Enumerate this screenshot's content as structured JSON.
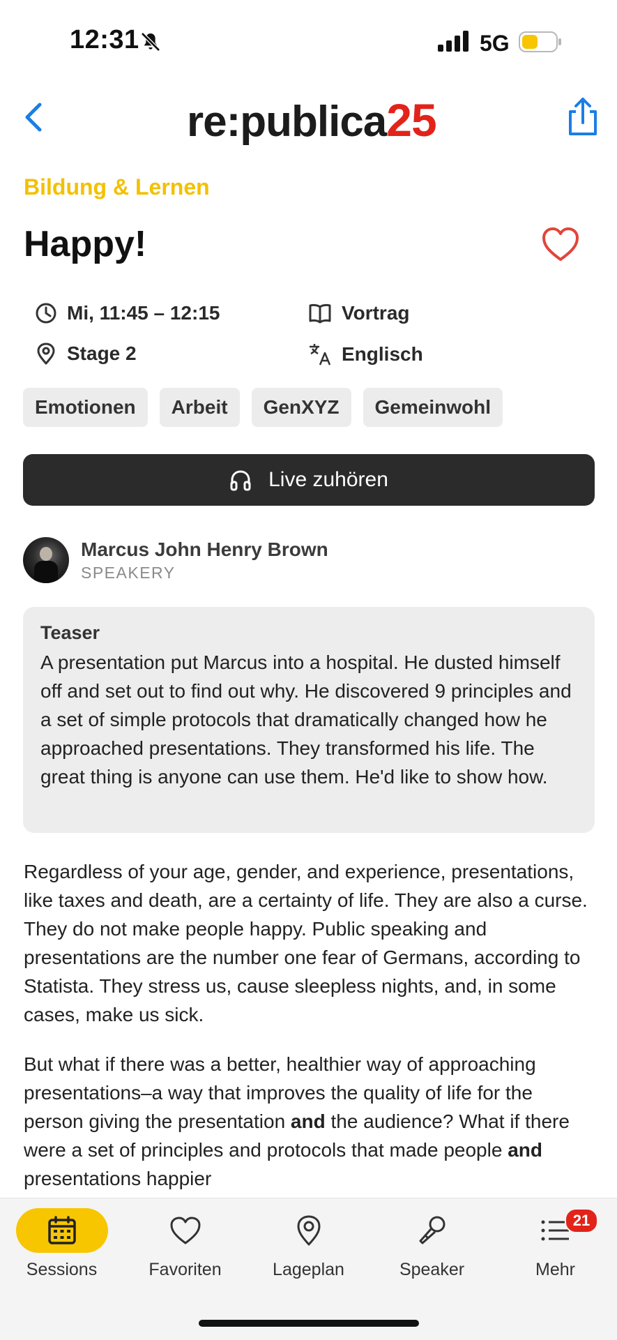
{
  "status_bar": {
    "time": "12:31",
    "network": "5G"
  },
  "header": {
    "logo_text": "re:publica",
    "logo_number": "25"
  },
  "session": {
    "category": "Bildung & Lernen",
    "title": "Happy!",
    "time": "Mi, 11:45 – 12:15",
    "format": "Vortrag",
    "location": "Stage 2",
    "language": "Englisch",
    "tags": [
      "Emotionen",
      "Arbeit",
      "GenXYZ",
      "Gemeinwohl"
    ],
    "listen_label": "Live zuhören"
  },
  "speaker": {
    "name": "Marcus John Henry Brown",
    "org": "SPEAKERY"
  },
  "teaser": {
    "label": "Teaser",
    "text": "A presentation put Marcus into a hospital. He dusted himself off and set out to find out why. He discovered 9 principles and a set of simple protocols that dramatically changed how he approached presentations. They transformed his life. The great thing is anyone can use them. He'd like to show how."
  },
  "description": {
    "p1": "Regardless of your age, gender, and experience, presentations, like taxes and death, are a certainty of life. They are also a curse. They do not make people happy. Public speaking and presentations are the number one fear of Germans, according to Statista. They stress us, cause sleepless nights, and, in some cases, make us sick.",
    "p2_a": "But what if there was a better, healthier way of approaching presentations–a way that improves the quality of life for the person giving the presentation ",
    "p2_b": "and",
    "p2_c": " the audience?  What if there were a set of principles and protocols that made people ",
    "p2_d": "and",
    "p2_e": " presentations happier"
  },
  "tabbar": {
    "items": [
      {
        "label": "Sessions",
        "icon": "calendar-icon",
        "active": true
      },
      {
        "label": "Favoriten",
        "icon": "heart-icon",
        "active": false
      },
      {
        "label": "Lageplan",
        "icon": "map-pin-icon",
        "active": false
      },
      {
        "label": "Speaker",
        "icon": "microphone-icon",
        "active": false
      },
      {
        "label": "Mehr",
        "icon": "list-icon",
        "active": false
      }
    ],
    "more_badge": "21"
  },
  "colors": {
    "accent_yellow": "#f7c600",
    "brand_red": "#e2231a",
    "link_blue": "#1a7ee6",
    "category_yellow": "#f2c100"
  }
}
